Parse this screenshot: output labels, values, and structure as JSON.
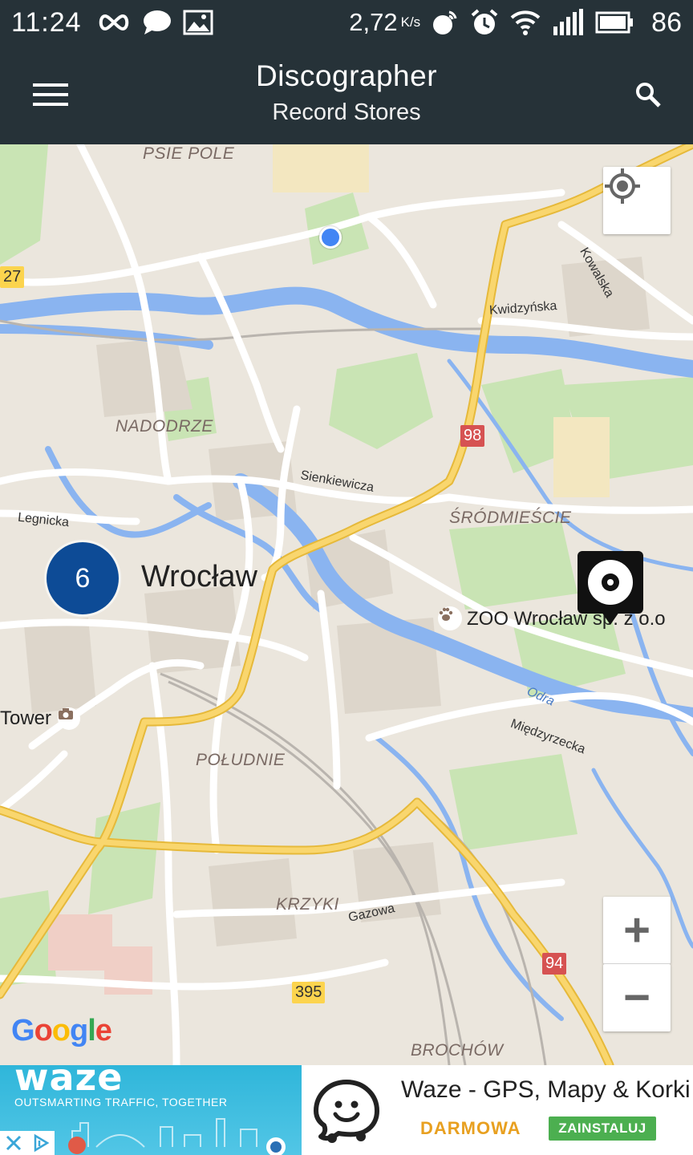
{
  "status_bar": {
    "time": "11:24",
    "net_speed": "2,72",
    "net_unit": "K/s",
    "battery": "86"
  },
  "app_bar": {
    "title": "Discographer",
    "subtitle": "Record Stores"
  },
  "map": {
    "districts": [
      "PSIE POLE",
      "NADODRZE",
      "ŚRÓDMIEŚCIE",
      "POŁUDNIE",
      "KRZYKI",
      "BROCHÓW"
    ],
    "streets": [
      "Kowalska",
      "Kwidzyńska",
      "Sienkiewicza",
      "Legnicka",
      "Międzyrzecka",
      "Gazowa",
      "Odra"
    ],
    "city": "Wrocław",
    "poi_zoo": "ZOO Wrocław sp. z o.o",
    "poi_tower": "Tower",
    "shields": [
      "27",
      "98",
      "94",
      "395"
    ],
    "cluster_count": "6",
    "google": "Google",
    "zoom_in": "+",
    "zoom_out": "−"
  },
  "ad": {
    "brand": "waze",
    "tagline": "OUTSMARTING TRAFFIC, TOGETHER",
    "title": "Waze - GPS, Mapy & Korki",
    "price": "DARMOWA",
    "install": "ZAINSTALUJ"
  },
  "colors": {
    "appbar": "#263238",
    "cluster": "#0d4b96",
    "highway": "#f7cf4e",
    "water": "#7eb3f5",
    "park": "#c8e5b3",
    "install": "#4caf50",
    "price": "#e8a020"
  }
}
